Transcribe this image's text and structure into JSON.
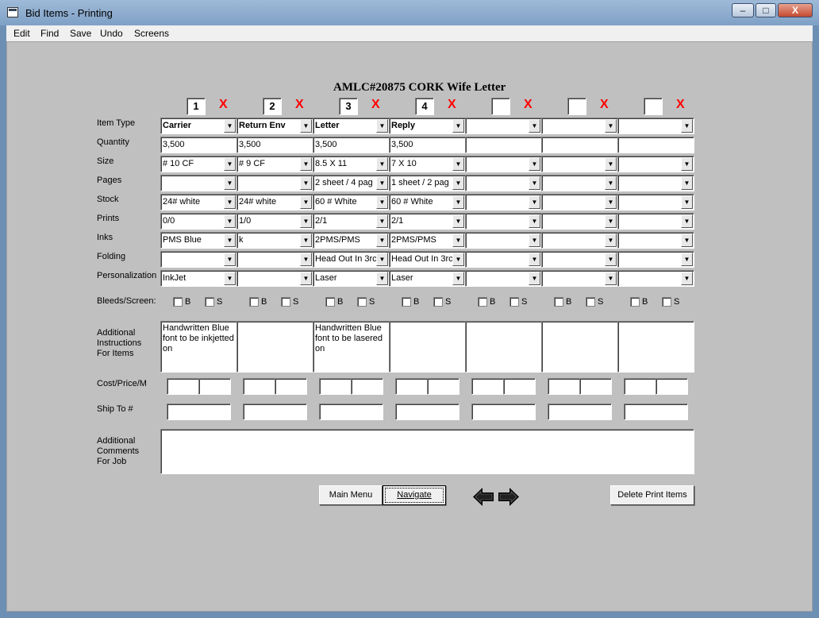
{
  "window": {
    "title": "Bid Items - Printing",
    "minimize": "–",
    "maximize": "□",
    "close": "X"
  },
  "menu": [
    "Edit",
    "Find",
    "Save",
    "Undo",
    "Screens"
  ],
  "form_title": "AMLC#20875  CORK  Wife Letter",
  "columns": [
    {
      "num": "1",
      "x_label": "X"
    },
    {
      "num": "2",
      "x_label": "X"
    },
    {
      "num": "3",
      "x_label": "X"
    },
    {
      "num": "4",
      "x_label": "X"
    },
    {
      "num": "",
      "x_label": "X"
    },
    {
      "num": "",
      "x_label": "X"
    },
    {
      "num": "",
      "x_label": "X"
    }
  ],
  "labels": {
    "item_type": "Item Type",
    "quantity": "Quantity",
    "size": "Size",
    "pages": "Pages",
    "stock": "Stock",
    "prints": "Prints",
    "inks": "Inks",
    "folding": "Folding",
    "personalization": "Personalization",
    "bleeds_screen": "Bleeds/Screen:",
    "additional_instructions": "Additional\nInstructions\nFor Items",
    "cost_price": "Cost/Price/M",
    "ship_to": "Ship To #",
    "additional_comments": "Additional\nComments\nFor Job"
  },
  "rows": {
    "item_type": [
      "Carrier",
      "Return Env",
      "Letter",
      "Reply",
      "",
      "",
      ""
    ],
    "quantity": [
      "3,500",
      "3,500",
      "3,500",
      "3,500",
      "",
      "",
      ""
    ],
    "size": [
      "# 10 CF",
      "#  9 CF",
      "8.5 X 11",
      "7 X 10",
      "",
      "",
      ""
    ],
    "pages": [
      "",
      "",
      "2 sheet / 4 pag",
      "1 sheet / 2 pag",
      "",
      "",
      ""
    ],
    "stock": [
      "24# white",
      "24# white",
      "60 # White",
      "60 # White",
      "",
      "",
      ""
    ],
    "prints": [
      "0/0",
      "1/0",
      "2/1",
      "2/1",
      "",
      "",
      ""
    ],
    "inks": [
      "PMS Blue",
      "k",
      "2PMS/PMS",
      "2PMS/PMS",
      "",
      "",
      ""
    ],
    "folding": [
      "",
      "",
      "Head Out In 3rc",
      "Head Out In 3rc",
      "",
      "",
      ""
    ],
    "personalization": [
      "InkJet",
      "",
      "Laser",
      "Laser",
      "",
      "",
      ""
    ]
  },
  "checkbox_labels": {
    "b": "B",
    "s": "S"
  },
  "instructions": [
    "Handwritten Blue\nfont to be inkjetted\non",
    "",
    "Handwritten Blue\nfont to be lasered\non",
    "",
    "",
    "",
    ""
  ],
  "comments": "",
  "buttons": {
    "main_menu": "Main Menu",
    "navigate": "Navigate",
    "delete_print_items": "Delete Print Items"
  },
  "icons": {
    "back": "left-arrow-icon",
    "forward": "right-arrow-icon",
    "dropdown": "chevron-down-icon"
  },
  "colors": {
    "remove_x": "#ff0000",
    "form_bg": "#c0c0c0"
  }
}
